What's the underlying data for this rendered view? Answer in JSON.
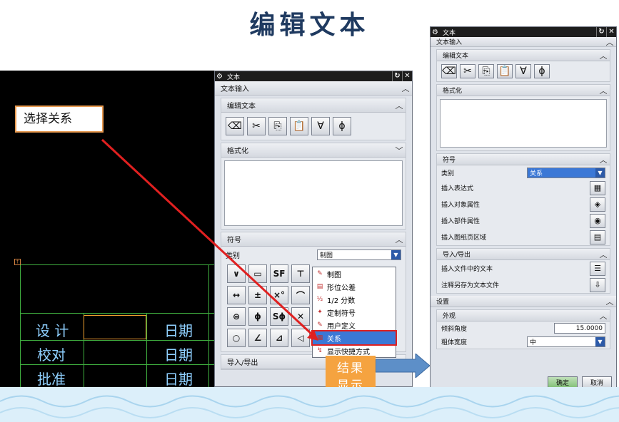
{
  "slide_title": "编辑文本",
  "cad": {
    "labels": [
      "设 计",
      "校对",
      "批准"
    ],
    "date_labels": [
      "日期",
      "日期",
      "日期"
    ],
    "marker": "†"
  },
  "callout_text": "选择关系",
  "result_text": "结果显示如图",
  "dialog1": {
    "title": "文本",
    "text_input": "文本输入",
    "edit_text": "编辑文本",
    "format": "格式化",
    "symbol": "符号",
    "category_label": "类别",
    "category_value": "制图",
    "import_export": "导入/导出",
    "symbols": [
      "∨",
      "▭",
      "SF",
      "⊤",
      "↔",
      "±",
      "×°",
      "⌒",
      "⊜",
      "ϕ",
      "Sϕ",
      "✕",
      "○",
      "∠",
      "⊿",
      "◁"
    ],
    "dropdown_options": [
      {
        "icon": "✎",
        "label": "制图"
      },
      {
        "icon": "▤",
        "label": "形位公差"
      },
      {
        "icon": "½",
        "label": "1/2 分数"
      },
      {
        "icon": "✦",
        "label": "定制符号"
      },
      {
        "icon": "✎",
        "label": "用户定义"
      },
      {
        "icon": "▦",
        "label": "关系"
      },
      {
        "icon": "↯",
        "label": "显示快捷方式"
      }
    ]
  },
  "dialog2": {
    "title": "文本",
    "text_input": "文本输入",
    "edit_text": "编辑文本",
    "format": "格式化",
    "symbol": "符号",
    "category_label": "类别",
    "category_value": "关系",
    "insert_expression": "插入表达式",
    "insert_object_attr": "插入对象属性",
    "insert_part_attr": "插入部件属性",
    "insert_sheet_region": "插入图纸页区域",
    "import_export": "导入/导出",
    "insert_file_text": "插入文件中的文本",
    "save_as_text_file": "注释另存为文本文件",
    "settings": "设置",
    "appearance": "外观",
    "slant_angle_label": "倾斜角度",
    "slant_angle_value": "15.0000",
    "weight_label": "粗体宽度",
    "weight_value": "中",
    "ok": "确定",
    "cancel": "取消"
  }
}
